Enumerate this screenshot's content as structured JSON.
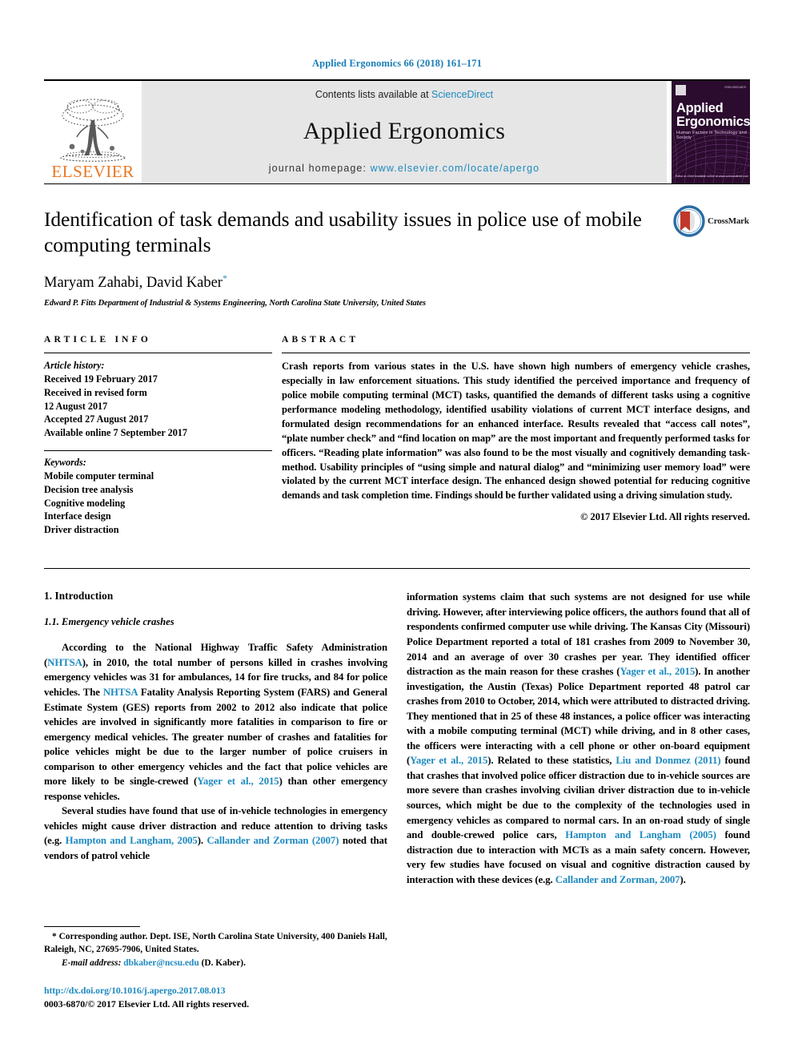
{
  "running_head": "Applied Ergonomics 66 (2018) 161–171",
  "masthead": {
    "publisher_name": "ELSEVIER",
    "contents_prefix": "Contents lists available at ",
    "sciencedirect": "ScienceDirect",
    "journal_title": "Applied Ergonomics",
    "homepage_label": "journal homepage: ",
    "homepage_url": "www.elsevier.com/locate/apergo",
    "cover": {
      "title_line1": "Applied",
      "title_line2": "Ergonomics",
      "subtitle": "Human Factors in Technology and Society",
      "corner_text": "ISSN 0003-6870",
      "footer_text": "Editor-in-Chief\nAvailable online at www.sciencedirect.com"
    }
  },
  "article": {
    "title": "Identification of task demands and usability issues in police use of mobile computing terminals",
    "authors": "Maryam Zahabi, David Kaber",
    "corresponding_marker": "*",
    "affiliation": "Edward P. Fitts Department of Industrial & Systems Engineering, North Carolina State University, United States",
    "crossmark_label": "CrossMark"
  },
  "article_info": {
    "heading": "ARTICLE INFO",
    "history_label": "Article history:",
    "history": [
      "Received 19 February 2017",
      "Received in revised form",
      "12 August 2017",
      "Accepted 27 August 2017",
      "Available online 7 September 2017"
    ],
    "keywords_label": "Keywords:",
    "keywords": [
      "Mobile computer terminal",
      "Decision tree analysis",
      "Cognitive modeling",
      "Interface design",
      "Driver distraction"
    ]
  },
  "abstract": {
    "heading": "ABSTRACT",
    "text": "Crash reports from various states in the U.S. have shown high numbers of emergency vehicle crashes, especially in law enforcement situations. This study identified the perceived importance and frequency of police mobile computing terminal (MCT) tasks, quantified the demands of different tasks using a cognitive performance modeling methodology, identified usability violations of current MCT interface designs, and formulated design recommendations for an enhanced interface. Results revealed that “access call notes”, “plate number check” and “find location on map” are the most important and frequently performed tasks for officers. “Reading plate information” was also found to be the most visually and cognitively demanding task-method. Usability principles of “using simple and natural dialog” and “minimizing user memory load” were violated by the current MCT interface design. The enhanced design showed potential for reducing cognitive demands and task completion time. Findings should be further validated using a driving simulation study.",
    "copyright": "© 2017 Elsevier Ltd. All rights reserved."
  },
  "body": {
    "section_number_title": "1. Introduction",
    "subsection_number_title": "1.1. Emergency vehicle crashes",
    "left_paragraph_1_part1": "According to the National Highway Traffic Safety Administration (",
    "left_ref_nhtsa_1": "NHTSA",
    "left_paragraph_1_part2": "), in 2010, the total number of persons killed in crashes involving emergency vehicles was 31 for ambulances, 14 for fire trucks, and 84 for police vehicles. The ",
    "left_ref_nhtsa_2": "NHTSA",
    "left_paragraph_1_part3": " Fatality Analysis Reporting System (FARS) and General Estimate System (GES) reports from 2002 to 2012 also indicate that police vehicles are involved in significantly more fatalities in comparison to fire or emergency medical vehicles. The greater number of crashes and fatalities for police vehicles might be due to the larger number of police cruisers in comparison to other emergency vehicles and the fact that police vehicles are more likely to be single-crewed (",
    "left_ref_yager_1": "Yager et al., 2015",
    "left_paragraph_1_part4": ") than other emergency response vehicles.",
    "left_paragraph_2_part1": "Several studies have found that use of in-vehicle technologies in emergency vehicles might cause driver distraction and reduce attention to driving tasks (e.g. ",
    "left_ref_hampton_1": "Hampton and Langham, 2005",
    "left_paragraph_2_part2": "). ",
    "left_ref_callander_1": "Callander and Zorman (2007)",
    "left_paragraph_2_part3": " noted that vendors of patrol vehicle",
    "right_paragraph_1_part1": "information systems claim that such systems are not designed for use while driving. However, after interviewing police officers, the authors found that all of respondents confirmed computer use while driving. The Kansas City (Missouri) Police Department reported a total of 181 crashes from 2009 to November 30, 2014 and an average of over 30 crashes per year. They identified officer distraction as the main reason for these crashes (",
    "right_ref_yager_1": "Yager et al., 2015",
    "right_paragraph_1_part2": "). In another investigation, the Austin (Texas) Police Department reported 48 patrol car crashes from 2010 to October, 2014, which were attributed to distracted driving. They mentioned that in 25 of these 48 instances, a police officer was interacting with a mobile computing terminal (MCT) while driving, and in 8 other cases, the officers were interacting with a cell phone or other on-board equipment (",
    "right_ref_yager_2": "Yager et al., 2015",
    "right_paragraph_1_part3": "). Related to these statistics, ",
    "right_ref_liu": "Liu and Donmez (2011)",
    "right_paragraph_1_part4": " found that crashes that involved police officer distraction due to in-vehicle sources are more severe than crashes involving civilian driver distraction due to in-vehicle sources, which might be due to the complexity of the technologies used in emergency vehicles as compared to normal cars. In an on-road study of single and double-crewed police cars, ",
    "right_ref_hampton_2": "Hampton and Langham (2005)",
    "right_paragraph_1_part5": " found distraction due to interaction with MCTs as a main safety concern. However, very few studies have focused on visual and cognitive distraction caused by interaction with these devices (e.g. ",
    "right_ref_callander_2": "Callander and Zorman, 2007",
    "right_paragraph_1_part6": ")."
  },
  "footnotes": {
    "corresponding_marker": "*",
    "corresponding_text": "Corresponding author. Dept. ISE, North Carolina State University, 400 Daniels Hall, Raleigh, NC, 27695-7906, United States.",
    "email_label": "E-mail address:",
    "email": "dbkaber@ncsu.edu",
    "email_suffix": "(D. Kaber).",
    "doi": "http://dx.doi.org/10.1016/j.apergo.2017.08.013",
    "issn_line": "0003-6870/© 2017 Elsevier Ltd. All rights reserved."
  },
  "colors": {
    "link_blue": "#1f8ac0",
    "running_head_blue": "#1a7db6",
    "elsevier_orange": "#e87722",
    "banner_gray": "#e6e6e6",
    "cover_purple": "#2b0b2e",
    "crossmark_red": "#c0392b",
    "crossmark_blue": "#2b6ca3"
  }
}
